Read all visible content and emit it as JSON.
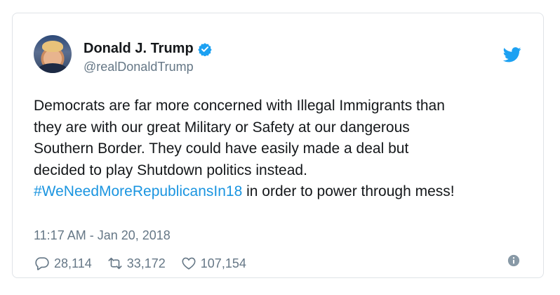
{
  "tweet": {
    "author_name": "Donald J. Trump",
    "handle": "@realDonaldTrump",
    "text_lines": [
      "Democrats are far more concerned with Illegal Immigrants than",
      "they are with our great Military or Safety at our dangerous",
      "Southern Border. They could have easily made a deal but",
      "decided to play Shutdown politics instead."
    ],
    "hashtag": "#WeNeedMoreRepublicansIn18",
    "text_tail": " in order to power through mess!",
    "timestamp": "11:17 AM - Jan 20, 2018",
    "replies": "28,114",
    "retweets": "33,172",
    "likes": "107,154"
  },
  "icons": {
    "verified": "verified-badge-icon",
    "brand": "twitter-bird-icon",
    "reply": "reply-icon",
    "retweet": "retweet-icon",
    "like": "heart-icon",
    "info": "info-icon"
  },
  "colors": {
    "brand": "#1da1f2",
    "text": "#14171a",
    "secondary": "#657786",
    "hashtag": "#1b95e0",
    "border": "#dfe3e7"
  }
}
